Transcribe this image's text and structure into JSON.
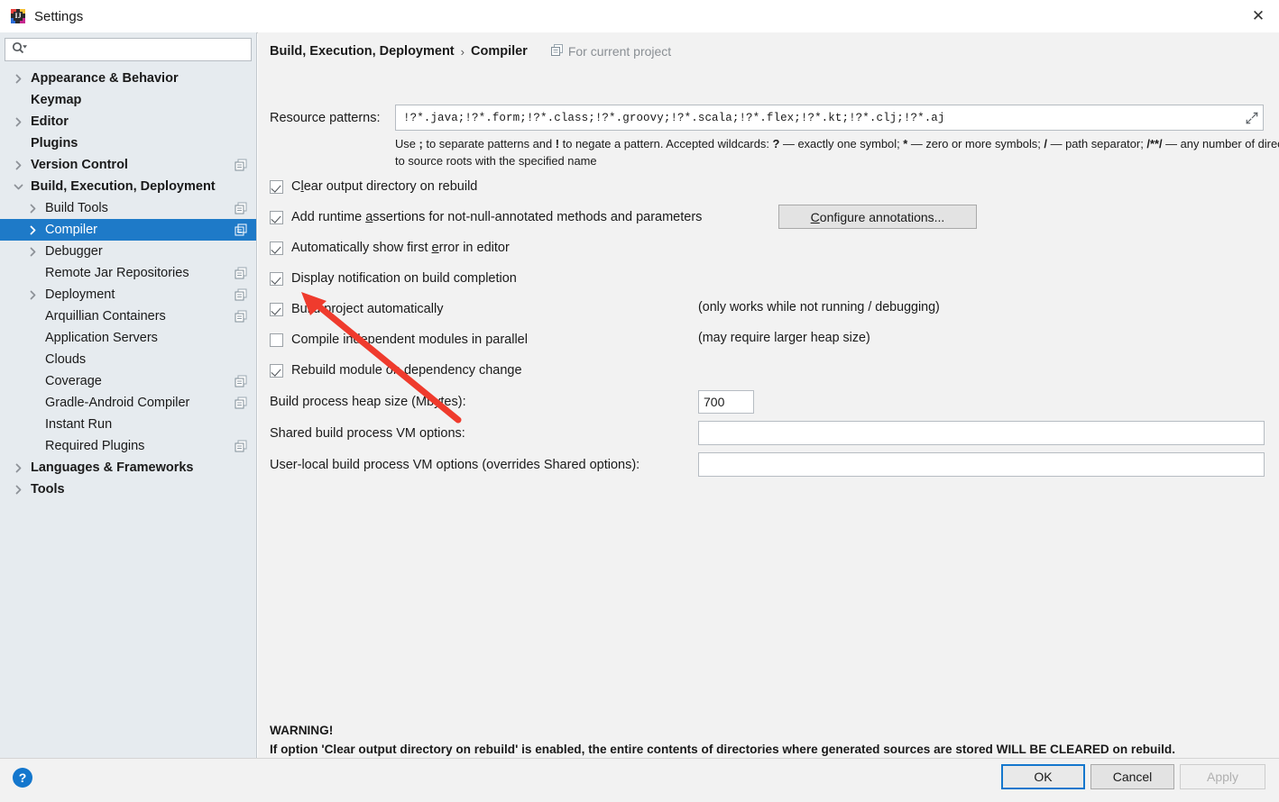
{
  "window": {
    "title": "Settings",
    "app_icon": "intellij-idea-icon",
    "close_icon": "close-icon"
  },
  "sidebar": {
    "search": {
      "placeholder": "",
      "value": "",
      "icon": "search-icon"
    },
    "items": [
      {
        "label": "Appearance & Behavior",
        "level": 0,
        "arrow": "collapsed",
        "project_icon": false,
        "selected": false
      },
      {
        "label": "Keymap",
        "level": 0,
        "arrow": "none",
        "project_icon": false,
        "selected": false
      },
      {
        "label": "Editor",
        "level": 0,
        "arrow": "collapsed",
        "project_icon": false,
        "selected": false
      },
      {
        "label": "Plugins",
        "level": 0,
        "arrow": "none",
        "project_icon": false,
        "selected": false
      },
      {
        "label": "Version Control",
        "level": 0,
        "arrow": "collapsed",
        "project_icon": true,
        "selected": false
      },
      {
        "label": "Build, Execution, Deployment",
        "level": 0,
        "arrow": "expanded",
        "project_icon": false,
        "selected": false
      },
      {
        "label": "Build Tools",
        "level": 1,
        "arrow": "collapsed",
        "project_icon": true,
        "selected": false
      },
      {
        "label": "Compiler",
        "level": 1,
        "arrow": "collapsed",
        "project_icon": true,
        "selected": true
      },
      {
        "label": "Debugger",
        "level": 1,
        "arrow": "collapsed",
        "project_icon": false,
        "selected": false
      },
      {
        "label": "Remote Jar Repositories",
        "level": 1,
        "arrow": "none",
        "project_icon": true,
        "selected": false
      },
      {
        "label": "Deployment",
        "level": 1,
        "arrow": "collapsed",
        "project_icon": true,
        "selected": false
      },
      {
        "label": "Arquillian Containers",
        "level": 1,
        "arrow": "none",
        "project_icon": true,
        "selected": false
      },
      {
        "label": "Application Servers",
        "level": 1,
        "arrow": "none",
        "project_icon": false,
        "selected": false
      },
      {
        "label": "Clouds",
        "level": 1,
        "arrow": "none",
        "project_icon": false,
        "selected": false
      },
      {
        "label": "Coverage",
        "level": 1,
        "arrow": "none",
        "project_icon": true,
        "selected": false
      },
      {
        "label": "Gradle-Android Compiler",
        "level": 1,
        "arrow": "none",
        "project_icon": true,
        "selected": false
      },
      {
        "label": "Instant Run",
        "level": 1,
        "arrow": "none",
        "project_icon": false,
        "selected": false
      },
      {
        "label": "Required Plugins",
        "level": 1,
        "arrow": "none",
        "project_icon": true,
        "selected": false
      },
      {
        "label": "Languages & Frameworks",
        "level": 0,
        "arrow": "collapsed",
        "project_icon": false,
        "selected": false
      },
      {
        "label": "Tools",
        "level": 0,
        "arrow": "collapsed",
        "project_icon": false,
        "selected": false
      }
    ]
  },
  "content": {
    "breadcrumb": {
      "parent": "Build, Execution, Deployment",
      "separator": "›",
      "current": "Compiler"
    },
    "for_current_project": "For current project",
    "resource_patterns": {
      "label": "Resource patterns:",
      "value": "!?*.java;!?*.form;!?*.class;!?*.groovy;!?*.scala;!?*.flex;!?*.kt;!?*.clj;!?*.aj",
      "expand_icon": "expand-icon"
    },
    "checkboxes": [
      {
        "label": "Clear output directory on rebuild",
        "mnemonic": "l",
        "checked": true,
        "note": ""
      },
      {
        "label": "Add runtime assertions for not-null-annotated methods and parameters",
        "mnemonic": "a",
        "checked": true,
        "note": ""
      },
      {
        "label": "Automatically show first error in editor",
        "mnemonic": "e",
        "checked": true,
        "note": ""
      },
      {
        "label": "Display notification on build completion",
        "mnemonic": "",
        "checked": true,
        "note": ""
      },
      {
        "label": "Build project automatically",
        "mnemonic": "",
        "checked": true,
        "note": "(only works while not running / debugging)"
      },
      {
        "label": "Compile independent modules in parallel",
        "mnemonic": "",
        "checked": false,
        "note": "(may require larger heap size)"
      },
      {
        "label": "Rebuild module on dependency change",
        "mnemonic": "",
        "checked": true,
        "note": ""
      }
    ],
    "configure_annotations_button": "Configure annotations...",
    "configure_annotations_mnemonic": "C",
    "fields": [
      {
        "label": "Build process heap size (Mbytes):",
        "value": "700"
      },
      {
        "label": "Shared build process VM options:",
        "value": ""
      },
      {
        "label": "User-local build process VM options (overrides Shared options):",
        "value": ""
      }
    ],
    "warning": {
      "title": "WARNING!",
      "body": "If option 'Clear output directory on rebuild' is enabled, the entire contents of directories where generated sources are stored WILL BE CLEARED on rebuild."
    }
  },
  "footer": {
    "help": "?",
    "ok": "OK",
    "cancel": "Cancel",
    "apply": "Apply"
  },
  "annotation": {
    "arrow_color": "#ef3b2d"
  }
}
